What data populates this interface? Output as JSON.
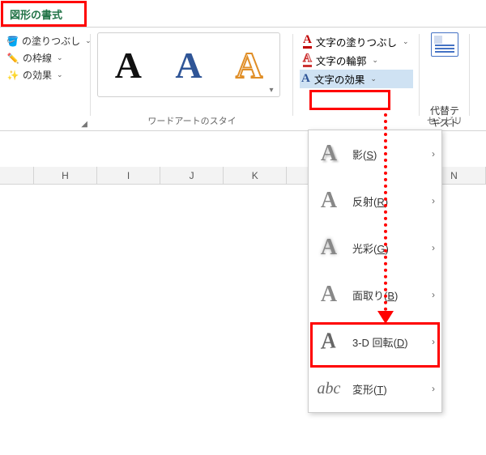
{
  "tab": {
    "shape_format": "図形の書式"
  },
  "shape_group": {
    "fill": "の塗りつぶし",
    "outline": "の枠線",
    "effects": "の効果"
  },
  "wordart_group_label": "ワードアートのスタイ",
  "text_group": {
    "fill": "文字の塗りつぶし",
    "outline": "文字の輪郭",
    "effects": "文字の効果"
  },
  "alt_text": {
    "line1": "代替テ",
    "line2": "キスト"
  },
  "accessibility_label": "セシビリ",
  "columns": [
    "",
    "H",
    "I",
    "J",
    "K",
    "",
    "",
    "N"
  ],
  "menu": {
    "shadow": "影",
    "shadow_key": "S",
    "reflection": "反射",
    "reflection_key": "R",
    "glow": "光彩",
    "glow_key": "G",
    "bevel": "面取り",
    "bevel_key": "B",
    "rotation3d": "3-D 回転",
    "rotation3d_key": "D",
    "transform": "変形",
    "transform_key": "T"
  }
}
